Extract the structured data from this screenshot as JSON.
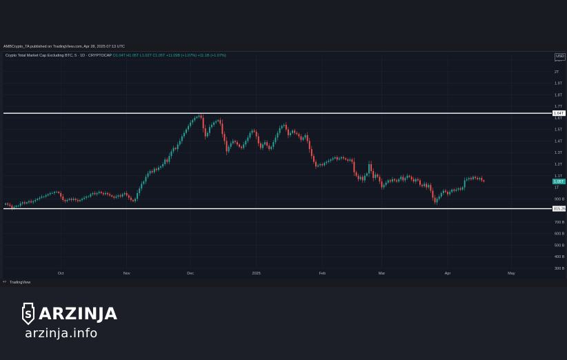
{
  "publisher_line": "AMBCrypto_TA published on TradingView.com, Apr 28, 2025 07:13 UTC",
  "legend": {
    "symbol": "Crypto Total Market Cap Excluding BTC, 5 · 1D · CRYPTOCAP",
    "o": "O1.04T",
    "h": "H1.05T",
    "l": "L1.02T",
    "c": "C1.05T",
    "change": "+11.09B (+1.07%)",
    "extra": "+11.1B (+1.07%)"
  },
  "currency_button": "USD",
  "footer_brand": "TradingView",
  "watermark": {
    "name": "ARZINJA",
    "url": "arzinja.info"
  },
  "chart_data": {
    "type": "candlestick",
    "y_axis": {
      "ticks": [
        {
          "value": 2.1,
          "label": "2.1T"
        },
        {
          "value": 2.0,
          "label": "2T"
        },
        {
          "value": 1.9,
          "label": "1.9T"
        },
        {
          "value": 1.8,
          "label": "1.8T"
        },
        {
          "value": 1.7,
          "label": "1.7T"
        },
        {
          "value": 1.6,
          "label": "1.6T"
        },
        {
          "value": 1.5,
          "label": "1.5T"
        },
        {
          "value": 1.4,
          "label": "1.4T"
        },
        {
          "value": 1.3,
          "label": "1.3T"
        },
        {
          "value": 1.2,
          "label": "1.2T"
        },
        {
          "value": 1.1,
          "label": "1.1T"
        },
        {
          "value": 1.0,
          "label": "1T"
        },
        {
          "value": 0.9,
          "label": "900 B"
        },
        {
          "value": 0.7,
          "label": "700 B"
        },
        {
          "value": 0.6,
          "label": "600 B"
        },
        {
          "value": 0.5,
          "label": "500 B"
        },
        {
          "value": 0.4,
          "label": "400 B"
        },
        {
          "value": 0.3,
          "label": "300 B"
        }
      ],
      "range": [
        0.3,
        2.1
      ]
    },
    "x_axis": {
      "ticks": [
        {
          "day": 26,
          "label": "Oct"
        },
        {
          "day": 57,
          "label": "Nov"
        },
        {
          "day": 87,
          "label": "Dec"
        },
        {
          "day": 118,
          "label": "2025"
        },
        {
          "day": 149,
          "label": "Feb"
        },
        {
          "day": 177,
          "label": "Mar"
        },
        {
          "day": 208,
          "label": "Apr"
        },
        {
          "day": 238,
          "label": "May"
        }
      ],
      "start": "2024-09-05",
      "range_days": [
        -1,
        257
      ]
    },
    "horizontal_levels": [
      {
        "value": 1.64,
        "label": "1.64T"
      },
      {
        "value": 0.81526,
        "label": "815.26"
      }
    ],
    "last_price": {
      "value": 1.05,
      "label": "1.05T"
    },
    "colors": {
      "up": "#26a69a",
      "down": "#ef5350",
      "level": "#ffffff",
      "grid": "#1f2330"
    },
    "candles_close": [
      0.86,
      0.85,
      0.84,
      0.82,
      0.83,
      0.84,
      0.84,
      0.86,
      0.87,
      0.86,
      0.87,
      0.88,
      0.87,
      0.88,
      0.89,
      0.9,
      0.91,
      0.92,
      0.92,
      0.93,
      0.94,
      0.95,
      0.95,
      0.96,
      0.96,
      0.95,
      0.92,
      0.89,
      0.88,
      0.89,
      0.9,
      0.89,
      0.9,
      0.89,
      0.88,
      0.89,
      0.9,
      0.91,
      0.92,
      0.92,
      0.94,
      0.95,
      0.94,
      0.95,
      0.96,
      0.95,
      0.94,
      0.95,
      0.94,
      0.93,
      0.92,
      0.91,
      0.92,
      0.93,
      0.92,
      0.94,
      0.95,
      0.93,
      0.91,
      0.89,
      0.88,
      0.9,
      0.95,
      0.99,
      1.03,
      1.05,
      1.09,
      1.12,
      1.14,
      1.13,
      1.16,
      1.15,
      1.17,
      1.18,
      1.2,
      1.24,
      1.22,
      1.27,
      1.31,
      1.34,
      1.33,
      1.37,
      1.4,
      1.44,
      1.47,
      1.5,
      1.53,
      1.56,
      1.58,
      1.6,
      1.61,
      1.62,
      1.6,
      1.51,
      1.44,
      1.47,
      1.52,
      1.54,
      1.56,
      1.57,
      1.58,
      1.55,
      1.46,
      1.4,
      1.31,
      1.35,
      1.38,
      1.4,
      1.39,
      1.37,
      1.35,
      1.34,
      1.37,
      1.4,
      1.43,
      1.47,
      1.49,
      1.48,
      1.44,
      1.38,
      1.34,
      1.37,
      1.39,
      1.36,
      1.33,
      1.35,
      1.39,
      1.43,
      1.47,
      1.51,
      1.53,
      1.54,
      1.5,
      1.45,
      1.47,
      1.49,
      1.47,
      1.46,
      1.44,
      1.41,
      1.43,
      1.45,
      1.4,
      1.33,
      1.27,
      1.22,
      1.18,
      1.19,
      1.2,
      1.19,
      1.21,
      1.22,
      1.23,
      1.24,
      1.25,
      1.26,
      1.24,
      1.25,
      1.26,
      1.25,
      1.24,
      1.23,
      1.24,
      1.22,
      1.13,
      1.1,
      1.07,
      1.09,
      1.06,
      1.1,
      1.12,
      1.2,
      1.14,
      1.08,
      1.11,
      1.09,
      1.05,
      1.0,
      1.02,
      1.04,
      1.06,
      1.05,
      1.07,
      1.06,
      1.05,
      1.07,
      1.09,
      1.06,
      1.08,
      1.1,
      1.09,
      1.07,
      1.05,
      1.07,
      1.06,
      1.02,
      1.01,
      1.03,
      1.0,
      1.02,
      0.97,
      0.91,
      0.87,
      0.9,
      0.92,
      0.95,
      0.97,
      0.96,
      0.94,
      0.96,
      0.98,
      0.97,
      0.98,
      0.99,
      0.98,
      1.0,
      1.06,
      1.07,
      1.08,
      1.07,
      1.09,
      1.08,
      1.07,
      1.08,
      1.06,
      1.05
    ]
  }
}
